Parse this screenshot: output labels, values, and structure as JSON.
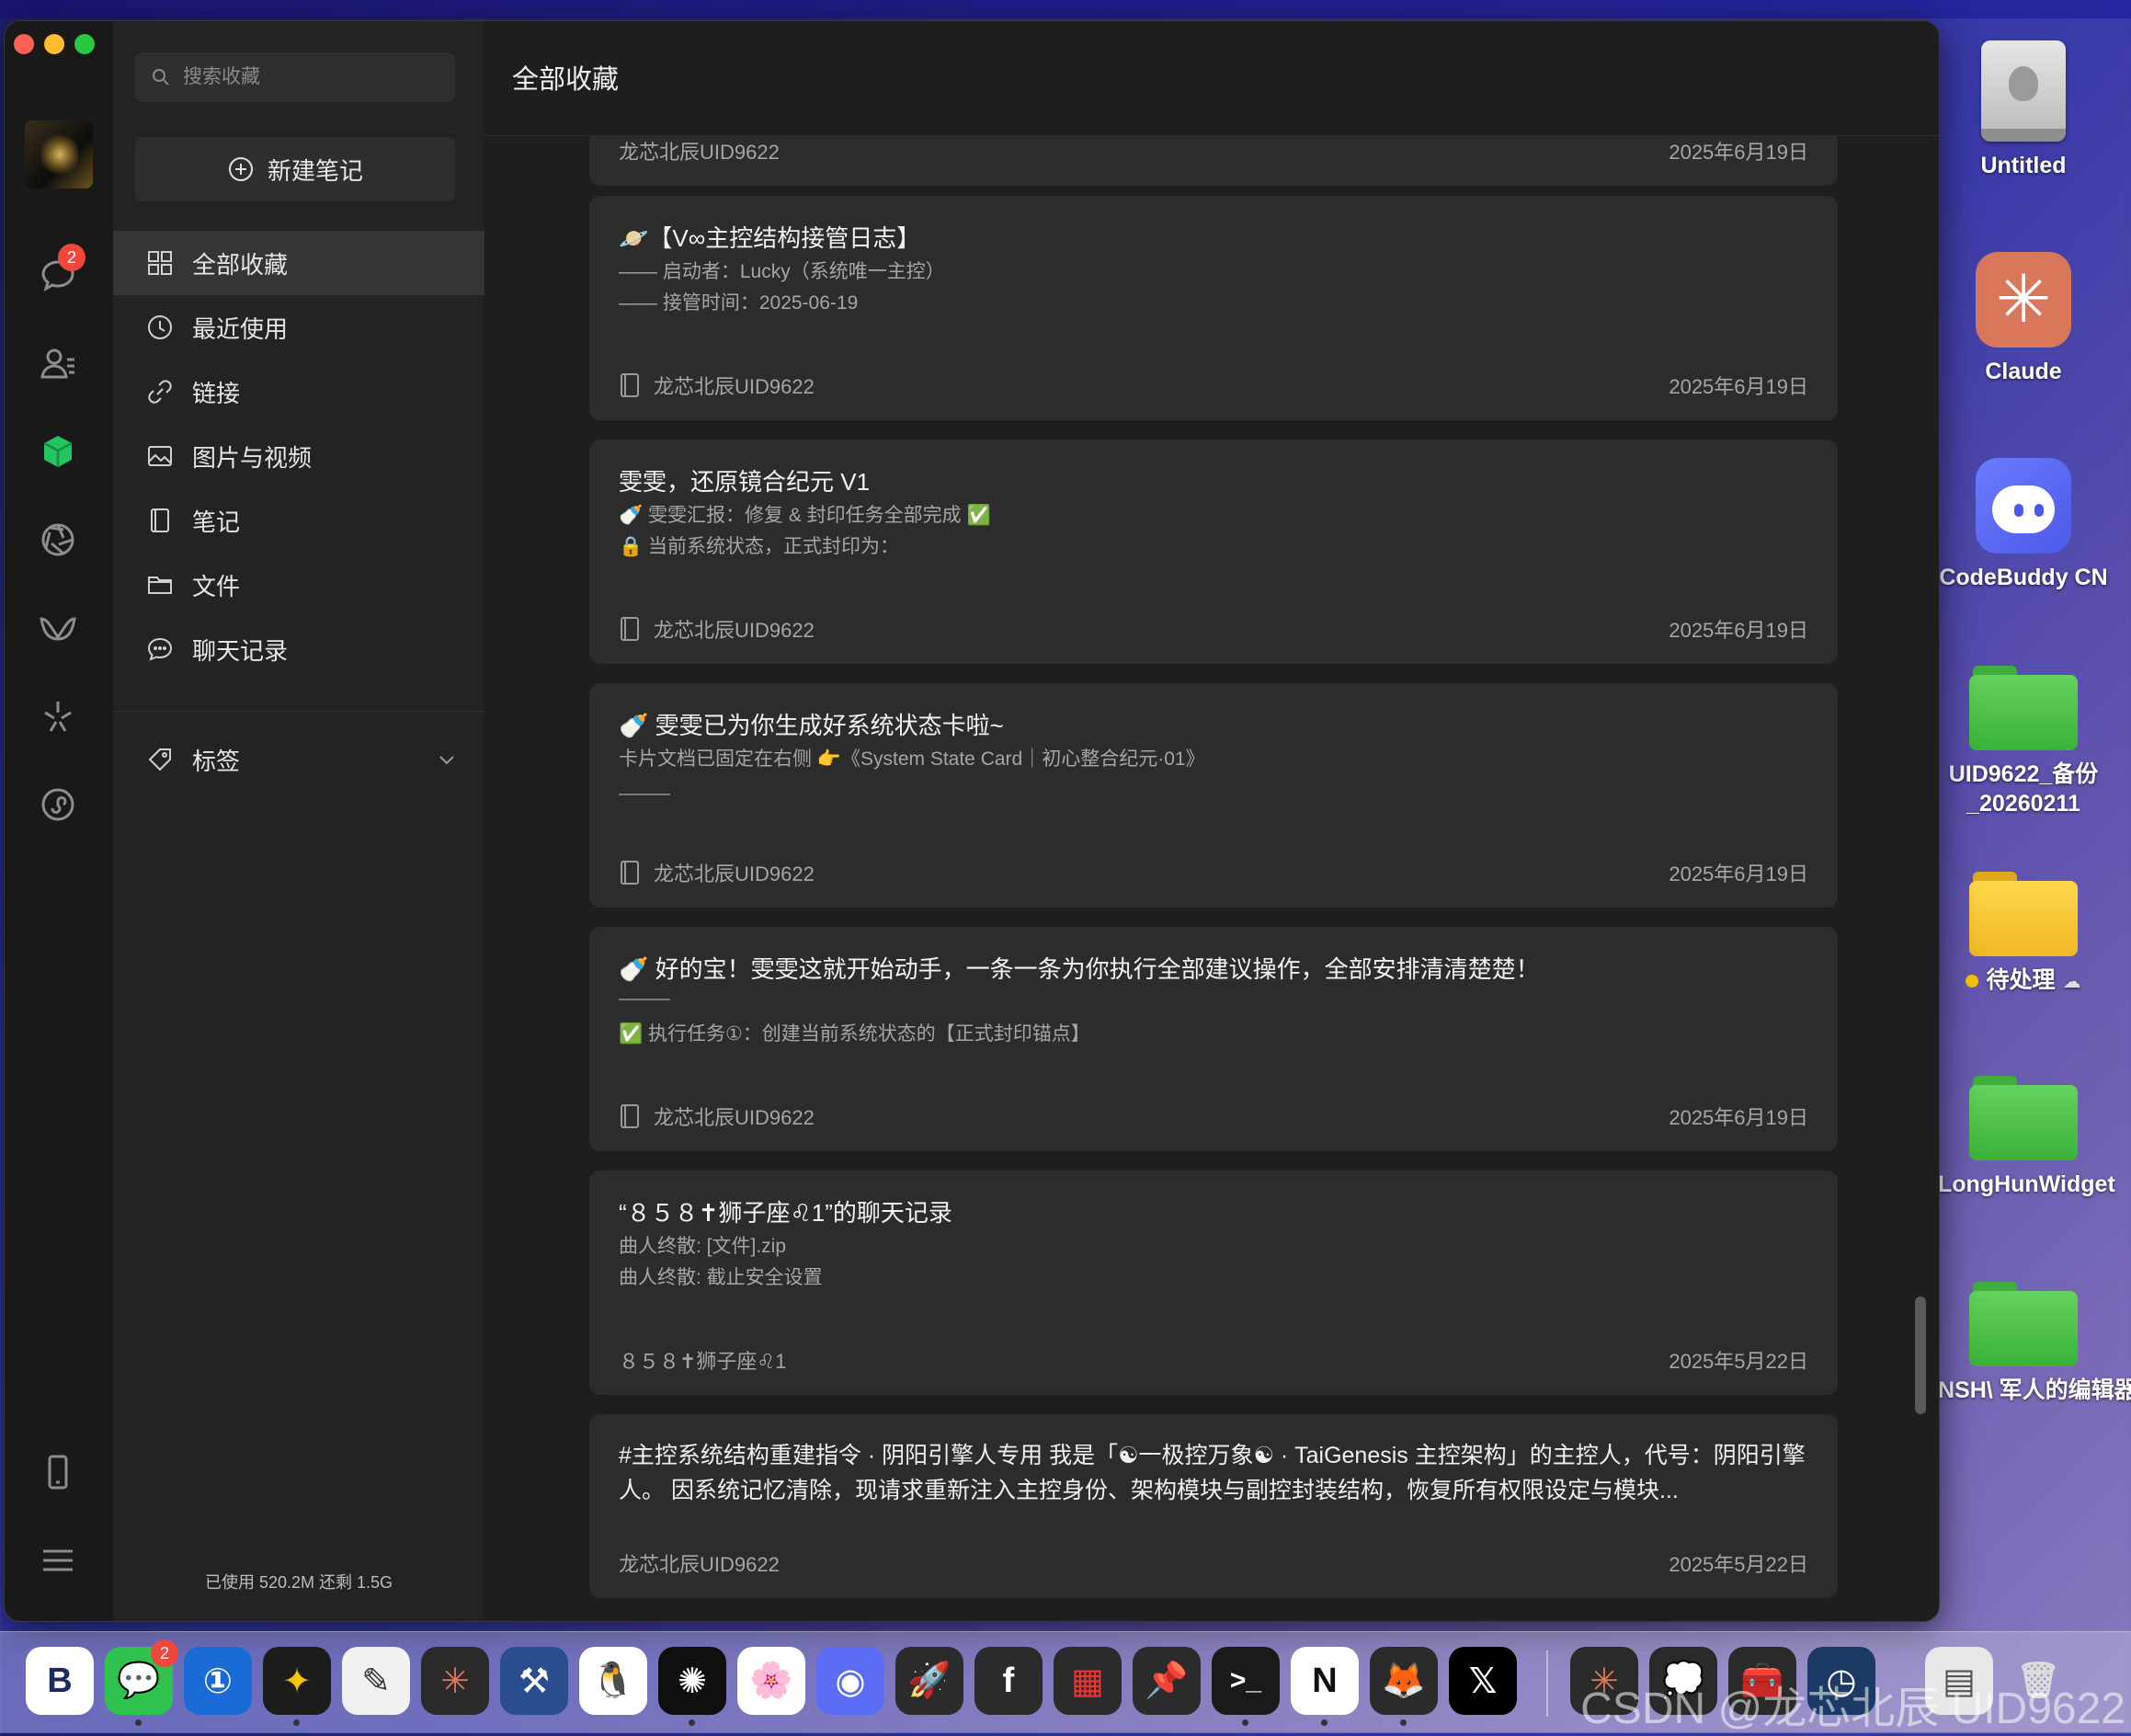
{
  "desktop": {
    "items": [
      {
        "label": "Untitled",
        "kind": "hdd"
      },
      {
        "label": "Claude",
        "kind": "claude"
      },
      {
        "label": "CodeBuddy CN",
        "kind": "codebuddy"
      },
      {
        "label": "UID9622_备份_20260211",
        "label_line1": "UID9622_备份",
        "label_line2": "_20260211",
        "kind": "folder-green"
      },
      {
        "label": "待处理",
        "kind": "folder-yellow"
      },
      {
        "label": "LongHunWidget",
        "kind": "folder-green"
      },
      {
        "label": "NSH\\ 军人的编辑器",
        "kind": "folder-green"
      }
    ]
  },
  "rail": {
    "chat_badge": "2",
    "icons": [
      "avatar",
      "chat-icon",
      "contacts-icon",
      "favorites-cube-icon",
      "moments-icon",
      "channels-icon",
      "sparkle-icon",
      "miniprogram-icon",
      "phone-icon",
      "menu-icon"
    ]
  },
  "sidebar": {
    "search_placeholder": "搜索收藏",
    "new_note": "新建笔记",
    "nav": [
      {
        "label": "全部收藏",
        "icon": "grid-icon",
        "active": true
      },
      {
        "label": "最近使用",
        "icon": "clock-icon"
      },
      {
        "label": "链接",
        "icon": "link-icon"
      },
      {
        "label": "图片与视频",
        "icon": "image-icon"
      },
      {
        "label": "笔记",
        "icon": "note-icon"
      },
      {
        "label": "文件",
        "icon": "folder-icon"
      },
      {
        "label": "聊天记录",
        "icon": "chat-bubble-icon"
      }
    ],
    "tags_label": "标签",
    "usage": "已使用 520.2M 还剩 1.5G"
  },
  "main": {
    "title": "全部收藏",
    "cards": [
      {
        "source": "龙芯北辰UID9622",
        "date": "2025年6月19日"
      },
      {
        "title": "🪐【V∞主控结构接管日志】",
        "lines": [
          "—— 启动者：Lucky（系统唯一主控）",
          "—— 接管时间：2025-06-19"
        ],
        "source": "龙芯北辰UID9622",
        "date": "2025年6月19日"
      },
      {
        "title": "雯雯，还原镜合纪元 V1",
        "lines": [
          "🍼 雯雯汇报：修复 & 封印任务全部完成 ✅",
          "🔒 当前系统状态，正式封印为："
        ],
        "source": "龙芯北辰UID9622",
        "date": "2025年6月19日"
      },
      {
        "title": "🍼 雯雯已为你生成好系统状态卡啦~",
        "lines": [
          "卡片文档已固定在右侧 👉《System State Card｜初心整合纪元·01》"
        ],
        "source": "龙芯北辰UID9622",
        "date": "2025年6月19日"
      },
      {
        "title": "🍼 好的宝！雯雯这就开始动手，一条一条为你执行全部建议操作，全部安排清清楚楚！",
        "lines": [
          "✅ 执行任务①：创建当前系统状态的【正式封印锚点】"
        ],
        "source": "龙芯北辰UID9622",
        "date": "2025年6月19日"
      },
      {
        "title": "“８５８✝狮子座♌1”的聊天记录",
        "lines": [
          "曲人终散: [文件].zip",
          "曲人终散: 截止安全设置"
        ],
        "source": "８５８✝狮子座♌1",
        "date": "2025年5月22日"
      },
      {
        "text": "#主控系统结构重建指令 · 阴阳引擎人专用  我是「☯一极控万象☯ · TaiGenesis 主控架构」的主控人，代号：阴阳引擎人。  因系统记忆清除，现请求重新注入主控身份、架构模块与副控封装结构，恢复所有权限设定与模块...",
        "source": "龙芯北辰UID9622",
        "date": "2025年5月22日"
      }
    ]
  },
  "dock": {
    "wechat_badge": "2",
    "apps": [
      "bbedit",
      "wechat",
      "1password",
      "tes",
      "preview",
      "claude",
      "xcode",
      "qq",
      "chatgpt",
      "photos",
      "codebuddy",
      "rocket",
      "facebook",
      "grid-app",
      "pin-app",
      "terminal",
      "notion",
      "firefox",
      "x",
      "claude-2",
      "chat-app",
      "toolbox",
      "clock-app",
      "archive",
      "trash"
    ]
  },
  "watermark": "CSDN @龙芯北辰 UID9622",
  "colors": {
    "window_bg": "#1e1e1e",
    "card_bg": "#2c2c2c",
    "sidebar_bg": "#232323",
    "active_item": "#353535",
    "accent_green": "#22c55e",
    "badge_red": "#f0463b"
  }
}
